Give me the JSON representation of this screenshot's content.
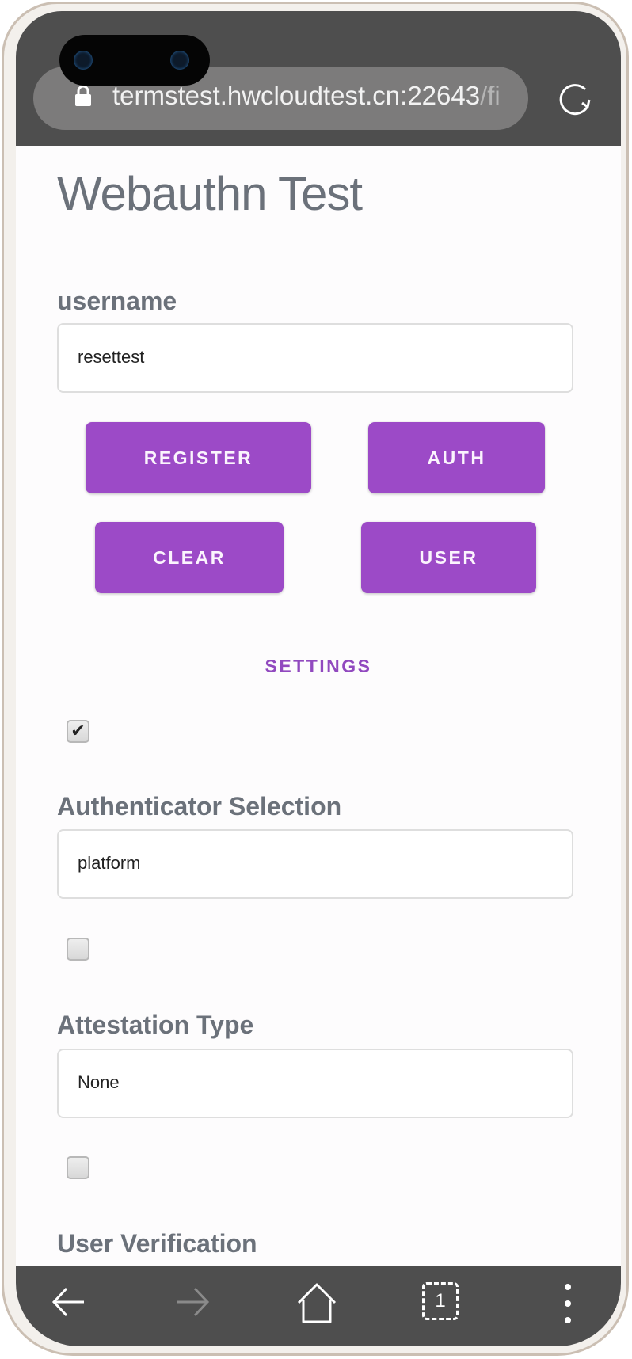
{
  "browser": {
    "url": "termstest.hwcloudtest.cn:22643",
    "url_overflow": "/fi",
    "icons": [
      "lock-icon",
      "reload-icon"
    ]
  },
  "page": {
    "title": "Webauthn Test",
    "username_label": "username",
    "username_value": "resettest",
    "buttons": {
      "register": "REGISTER",
      "auth": "AUTH",
      "clear": "CLEAR",
      "user": "USER"
    },
    "settings_label": "SETTINGS",
    "settings": [
      {
        "checked": true,
        "label": "Authenticator Selection",
        "value": "platform"
      },
      {
        "checked": false,
        "label": "Attestation Type",
        "value": "None"
      },
      {
        "checked": false,
        "label": "User Verification"
      }
    ],
    "accent_color": "#9c4ac7"
  },
  "bottom_nav": {
    "icons": [
      "back-arrow-icon",
      "forward-arrow-icon",
      "home-icon",
      "tabs-icon",
      "more-vertical-icon"
    ],
    "tab_count": "1"
  }
}
